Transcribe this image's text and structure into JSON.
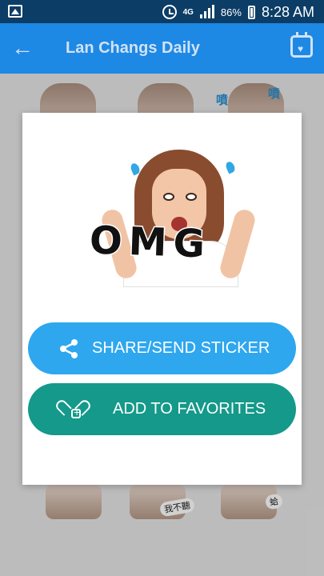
{
  "status_bar": {
    "network": "4G",
    "battery_percent": "86%",
    "time": "8:28 AM",
    "icons": [
      "gallery-icon",
      "alarm-icon",
      "signal-icon",
      "battery-icon"
    ]
  },
  "app_bar": {
    "title": "Lan Changs Daily",
    "back_icon": "arrow-left-icon",
    "calendar_icon": "calendar-heart-icon"
  },
  "background_stickers": [
    {
      "label": "我不聽"
    },
    {
      "label": "蛤"
    },
    {
      "label": "噴"
    }
  ],
  "dialog": {
    "sticker_text": "OMG",
    "share_button": {
      "label": "SHARE/SEND STICKER",
      "icon": "share-icon"
    },
    "favorite_button": {
      "label": "ADD TO FAVORITES",
      "icon": "heart-plus-icon"
    }
  },
  "colors": {
    "status_bar": "#0b3d66",
    "app_bar": "#1e88e5",
    "share_button": "#2ea7ef",
    "favorite_button": "#14998a"
  }
}
